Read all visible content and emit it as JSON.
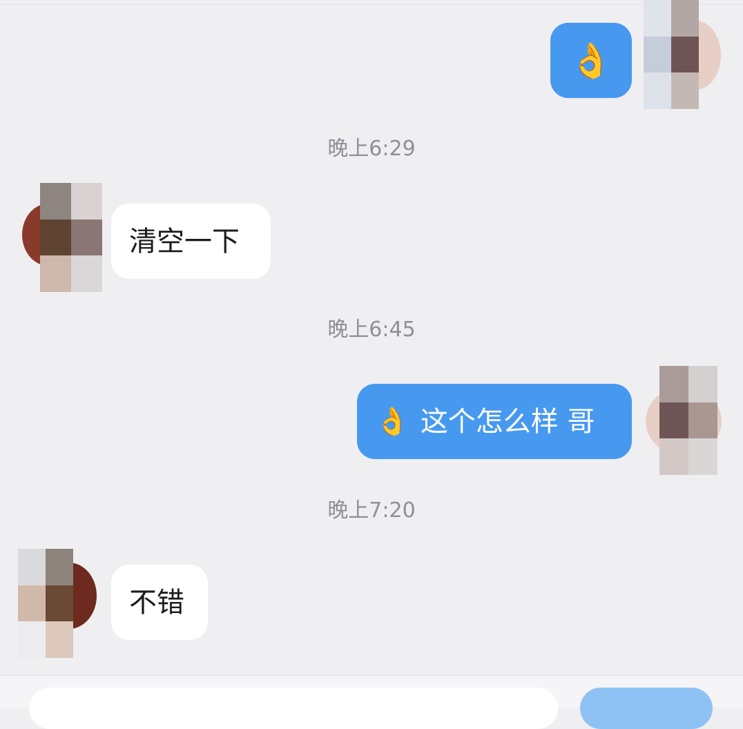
{
  "chat": {
    "timestamps": [
      "晚上6:29",
      "晚上6:45",
      "晚上7:20"
    ],
    "messages": [
      {
        "direction": "outgoing",
        "emoji": "👌",
        "text": ""
      },
      {
        "direction": "incoming",
        "emoji": "",
        "text": "清空一下"
      },
      {
        "direction": "outgoing",
        "emoji": "👌",
        "text": "这个怎么样 哥"
      },
      {
        "direction": "incoming",
        "emoji": "",
        "text": "不错"
      }
    ]
  },
  "icons": {
    "ok_hand": "ok-hand-emoji"
  },
  "colors": {
    "background": "#efeff2",
    "outgoing_bubble": "#4799f0",
    "incoming_bubble": "#ffffff",
    "timestamp_text": "#8f8f94",
    "send_button": "#8fc2f4"
  }
}
